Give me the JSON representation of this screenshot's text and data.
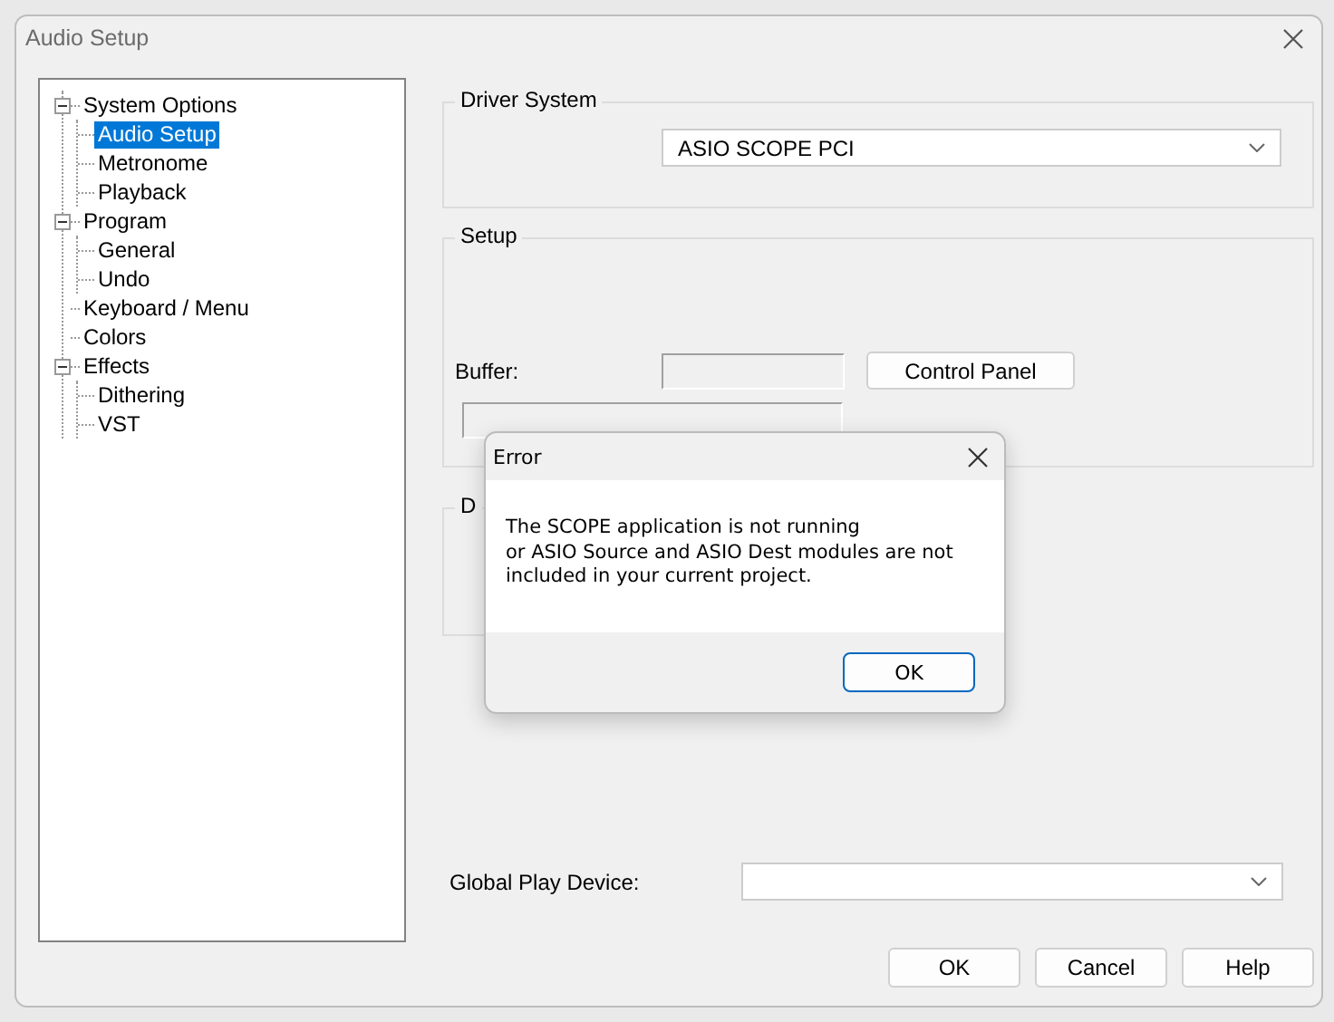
{
  "window": {
    "title": "Audio Setup"
  },
  "tree": [
    {
      "label": "System Options",
      "expanded": true,
      "selected": false,
      "children": [
        {
          "label": "Audio Setup",
          "selected": true
        },
        {
          "label": "Metronome",
          "selected": false
        },
        {
          "label": "Playback",
          "selected": false
        }
      ]
    },
    {
      "label": "Program",
      "expanded": true,
      "selected": false,
      "children": [
        {
          "label": "General",
          "selected": false
        },
        {
          "label": "Undo",
          "selected": false
        }
      ]
    },
    {
      "label": "Keyboard / Menu",
      "selected": false
    },
    {
      "label": "Colors",
      "selected": false
    },
    {
      "label": "Effects",
      "expanded": true,
      "selected": false,
      "children": [
        {
          "label": "Dithering",
          "selected": false
        },
        {
          "label": "VST",
          "selected": false
        }
      ]
    }
  ],
  "driver_group": {
    "title": "Driver System",
    "driver": {
      "value": "ASIO SCOPE PCI"
    }
  },
  "setup_group": {
    "title": "Setup",
    "buffer_label": "Buffer:",
    "control_panel_button": "Control Panel"
  },
  "third_group": {
    "title": "D"
  },
  "global_play_device": {
    "label": "Global Play Device:"
  },
  "buttons": [
    "OK",
    "Cancel",
    "Help"
  ],
  "error_dialog": {
    "title": "Error",
    "message": "The SCOPE application is not running\nor ASIO Source and ASIO Dest modules are not\nincluded in your current project.",
    "button": "OK"
  }
}
